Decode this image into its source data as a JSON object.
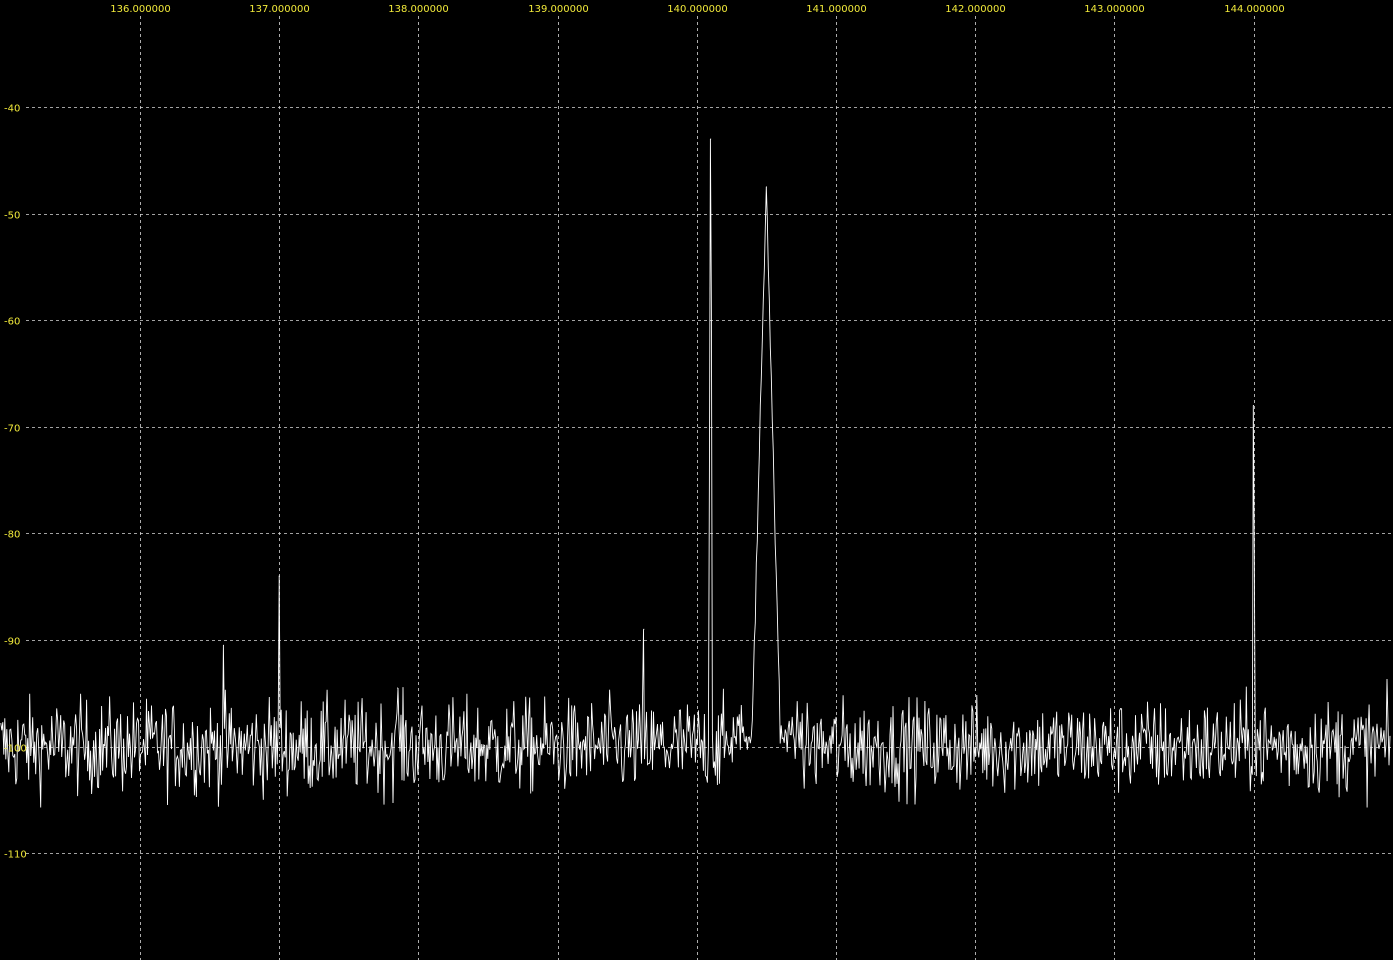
{
  "colors": {
    "background": "#000000",
    "grid": "#d8d8d8",
    "labels": "#f2ea3a",
    "trace": "#ffffff"
  },
  "chart_data": {
    "type": "line",
    "title": "",
    "xlabel": "",
    "ylabel": "",
    "grid": true,
    "xlim": [
      135.0,
      144.98
    ],
    "ylim": [
      -49.9,
      139.1
    ],
    "x_ticks": [
      {
        "value": 136.0,
        "label": "136.000000"
      },
      {
        "value": 137.0,
        "label": "137.000000"
      },
      {
        "value": 138.0,
        "label": "138.000000"
      },
      {
        "value": 139.0,
        "label": "139.000000"
      },
      {
        "value": 140.0,
        "label": "140.000000"
      },
      {
        "value": 141.0,
        "label": "141.000000"
      },
      {
        "value": 142.0,
        "label": "142.000000"
      },
      {
        "value": 143.0,
        "label": "143.000000"
      },
      {
        "value": 144.0,
        "label": "144.000000"
      }
    ],
    "y_ticks": [
      {
        "value": -40,
        "label": "-40"
      },
      {
        "value": -50,
        "label": "-50"
      },
      {
        "value": -60,
        "label": "-60"
      },
      {
        "value": -70,
        "label": "-70"
      },
      {
        "value": -80,
        "label": "-80"
      },
      {
        "value": -90,
        "label": "-90"
      },
      {
        "value": -100,
        "label": "-100"
      },
      {
        "value": -110,
        "label": "-110"
      }
    ],
    "y_axis_visible_range_top": -31,
    "y_axis_visible_range_bottom": -119,
    "series": [
      {
        "noise_floor": -100,
        "peaks": [
          {
            "x": 136.6,
            "y": -90.5
          },
          {
            "x": 137.0,
            "y": -84.0
          },
          {
            "x": 137.85,
            "y": -94.5
          },
          {
            "x": 139.62,
            "y": -89.0
          },
          {
            "x": 140.1,
            "y": -43.0
          },
          {
            "x": 140.5,
            "y": -47.5
          },
          {
            "x": 144.0,
            "y": -68.0
          }
        ]
      }
    ]
  }
}
